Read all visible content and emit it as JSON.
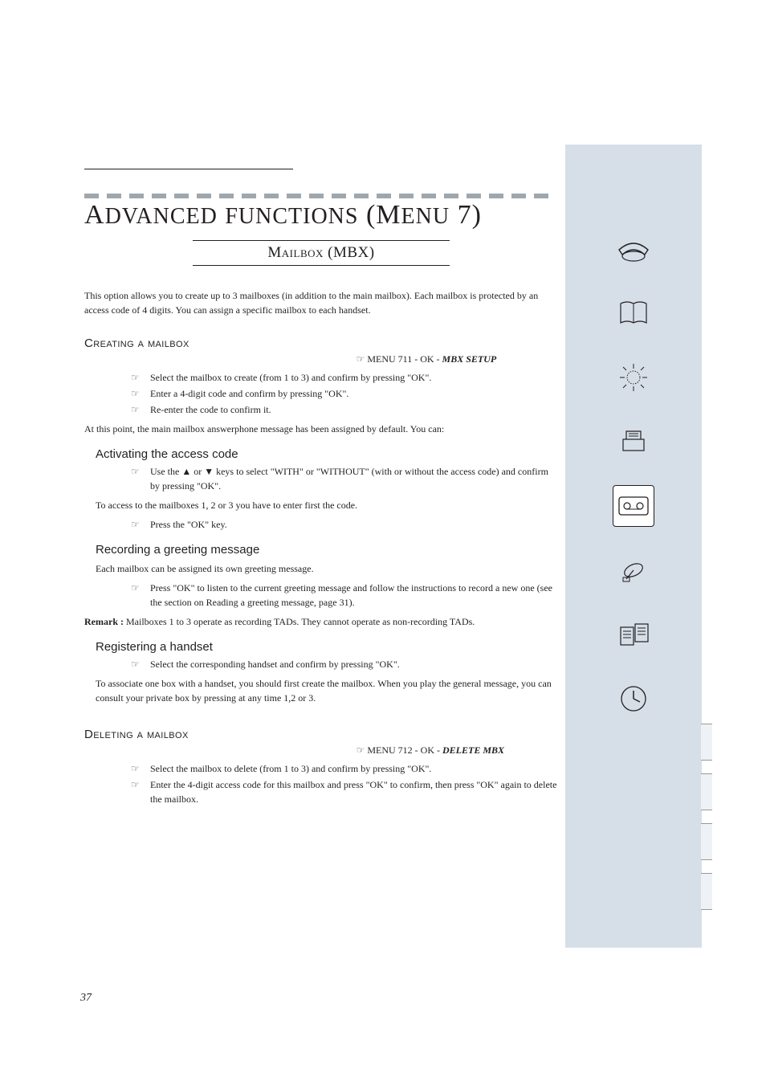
{
  "page": {
    "title_html": "A<span style='font-size:28px'>DVANCED</span> <span style='font-size:28px'>FUNCTIONS</span> (M<span style='font-size:28px'>ENU</span> 7)",
    "subtitle": "Mailbox (MBX)",
    "intro": "This option allows you to create up to 3 mailboxes (in addition to the main mailbox). Each mailbox is protected by an access code of 4 digits. You can assign a specific mailbox to each handset.",
    "creating": {
      "heading": "Creating a mailbox",
      "menu_path_prefix": "MENU 711 - OK - ",
      "menu_path_bold": "MBX SETUP",
      "step1": "Select the mailbox to create (from 1 to 3) and confirm by pressing \"OK\".",
      "step2": "Enter a 4-digit code and confirm by pressing \"OK\".",
      "step3": "Re-enter the code to confirm it.",
      "note": "At this point, the main mailbox answerphone message has been assigned by default. You can:"
    },
    "access_code": {
      "heading": "Activating the access code",
      "step1_before": "Use the ",
      "step1_after": " keys to select \"WITH\" or \"WITHOUT\" (with or without the access code) and confirm by pressing \"OK\".",
      "line": "To access to the mailboxes 1, 2 or 3 you have to enter first the code.",
      "step2": "Press the \"OK\" key."
    },
    "greeting": {
      "heading": "Recording a greeting message",
      "line": "Each mailbox can be assigned its own greeting message.",
      "step1": "Press \"OK\" to listen to the current greeting message and follow the instructions to record a new one (see the section on Reading a greeting message, page 31).",
      "note_prefix": "Remark : ",
      "note": "Mailboxes 1 to 3 operate as recording TADs. They cannot operate as non-recording TADs."
    },
    "handset": {
      "heading": "Registering a handset",
      "step1": "Select the corresponding handset and confirm by pressing \"OK\".",
      "line": "To associate one box with a handset, you should first create the mailbox. When you play the general message, you can consult your private box by pressing at any time 1,2 or 3."
    },
    "deleting": {
      "heading": "Deleting a mailbox",
      "menu_path_prefix": "MENU 712 - OK - ",
      "menu_path_bold": "DELETE MBX",
      "step1": "Select the mailbox to delete (from 1 to 3) and confirm by pressing \"OK\".",
      "step2": "Enter the 4-digit access code for this mailbox and press \"OK\" to confirm, then press \"OK\" again to delete the mailbox."
    },
    "page_number": "37"
  },
  "sidebar": {
    "icons": [
      "phone-icon",
      "book-icon",
      "sun-icon",
      "fax-icon",
      "tape-icon",
      "satellite-icon",
      "documents-icon",
      "clock-icon"
    ],
    "active_index": 4
  }
}
